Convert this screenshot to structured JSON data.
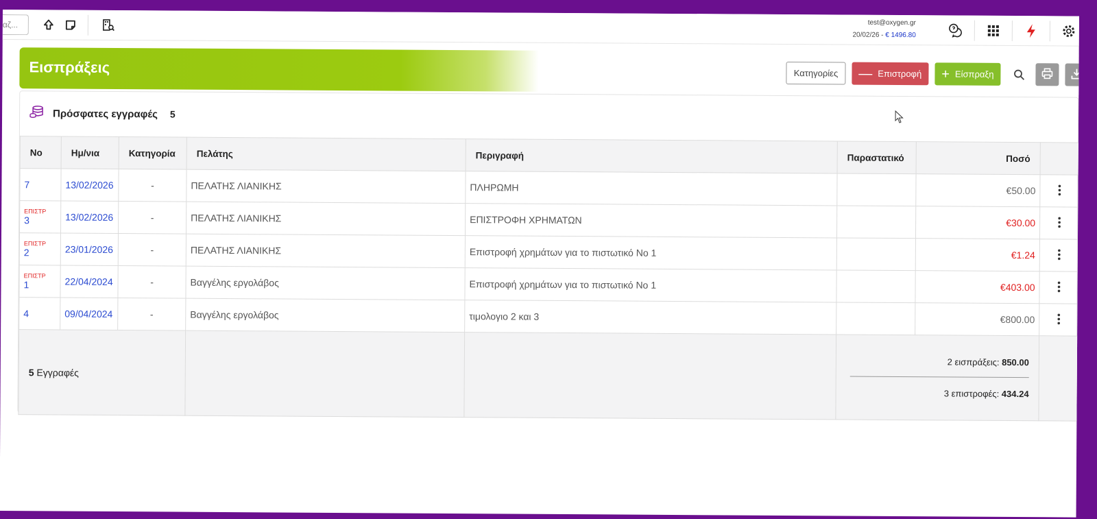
{
  "topbar": {
    "search_stub": "αζ...",
    "user_email": "test@oxygen.gr",
    "date": "20/02/26",
    "balance_sep": " - ",
    "balance": "€ 1496.80"
  },
  "header": {
    "title": "Εισπράξεις",
    "categories_label": "Κατηγορίες",
    "return_label": "Επιστροφή",
    "receipt_label": "Είσπραξη"
  },
  "panel": {
    "title": "Πρόσφατες εγγραφές",
    "count": "5"
  },
  "table": {
    "columns": [
      "Νο",
      "Ημ/νια",
      "Κατηγορία",
      "Πελάτης",
      "Περιγραφή",
      "Παραστατικό",
      "Ποσό"
    ],
    "rows": [
      {
        "tag": "",
        "no": "7",
        "date": "13/02/2026",
        "category": "-",
        "customer": "ΠΕΛΑΤΗΣ ΛΙΑΝΙΚΗΣ",
        "description": "ΠΛΗΡΩΜΗ",
        "document": "",
        "amount": "€50.00"
      },
      {
        "tag": "ΕΠΙΣΤΡ",
        "no": "3",
        "date": "13/02/2026",
        "category": "-",
        "customer": "ΠΕΛΑΤΗΣ ΛΙΑΝΙΚΗΣ",
        "description": "ΕΠΙΣΤΡΟΦΗ ΧΡΗΜΑΤΩΝ",
        "document": "",
        "amount": "€30.00"
      },
      {
        "tag": "ΕΠΙΣΤΡ",
        "no": "2",
        "date": "23/01/2026",
        "category": "-",
        "customer": "ΠΕΛΑΤΗΣ ΛΙΑΝΙΚΗΣ",
        "description": "Επιστροφή χρημάτων για το πιστωτικό Νο 1",
        "document": "",
        "amount": "€1.24"
      },
      {
        "tag": "ΕΠΙΣΤΡ",
        "no": "1",
        "date": "22/04/2024",
        "category": "-",
        "customer": "Βαγγέλης εργολάβος",
        "description": "Επιστροφή χρημάτων για το πιστωτικό Νο 1",
        "document": "",
        "amount": "€403.00"
      },
      {
        "tag": "",
        "no": "4",
        "date": "09/04/2024",
        "category": "-",
        "customer": "Βαγγέλης εργολάβος",
        "description": "τιμολογιο 2 και 3",
        "document": "",
        "amount": "€800.00"
      }
    ],
    "footer": {
      "records_count": "5",
      "records_label": "Εγγραφές",
      "receipts_label": "2 εισπράξεις:",
      "receipts_total": "850.00",
      "returns_label": "3 επιστροφές:",
      "returns_total": "434.24"
    }
  },
  "colors": {
    "frame": "#6a0f8e",
    "header_green": "#96c511",
    "return_red": "#cf4d55",
    "receipt_green": "#86bf2a",
    "link_blue": "#2b4bd1",
    "negative_red": "#e01f1f"
  },
  "icons": [
    "upload-icon",
    "note-icon",
    "building-search-icon",
    "help-chat-icon",
    "apps-grid-icon",
    "lightning-icon",
    "settings-icon",
    "database-coins-icon",
    "search-icon",
    "print-icon",
    "download-icon",
    "kebab-menu-icon",
    "mouse-cursor-icon"
  ]
}
